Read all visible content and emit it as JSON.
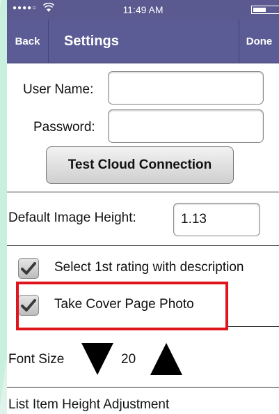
{
  "status": {
    "signal": "●●●●○",
    "time": "11:49 AM"
  },
  "nav": {
    "back": "Back",
    "title": "Settings",
    "done": "Done"
  },
  "form": {
    "username_label": "User Name:",
    "username_value": "",
    "password_label": "Password:",
    "password_value": "",
    "test_button": "Test Cloud Connection"
  },
  "image_height": {
    "label": "Default Image Height:",
    "value": "1.13"
  },
  "options": [
    {
      "label": "Select 1st rating with description",
      "checked": true
    },
    {
      "label": "Take Cover Page Photo",
      "checked": true
    }
  ],
  "font_size": {
    "label": "Font Size",
    "value": "20"
  },
  "list_item_height": {
    "label": "List Item Height Adjustment"
  },
  "colors": {
    "nav": "#5b5b95",
    "highlight": "#e0141c"
  }
}
